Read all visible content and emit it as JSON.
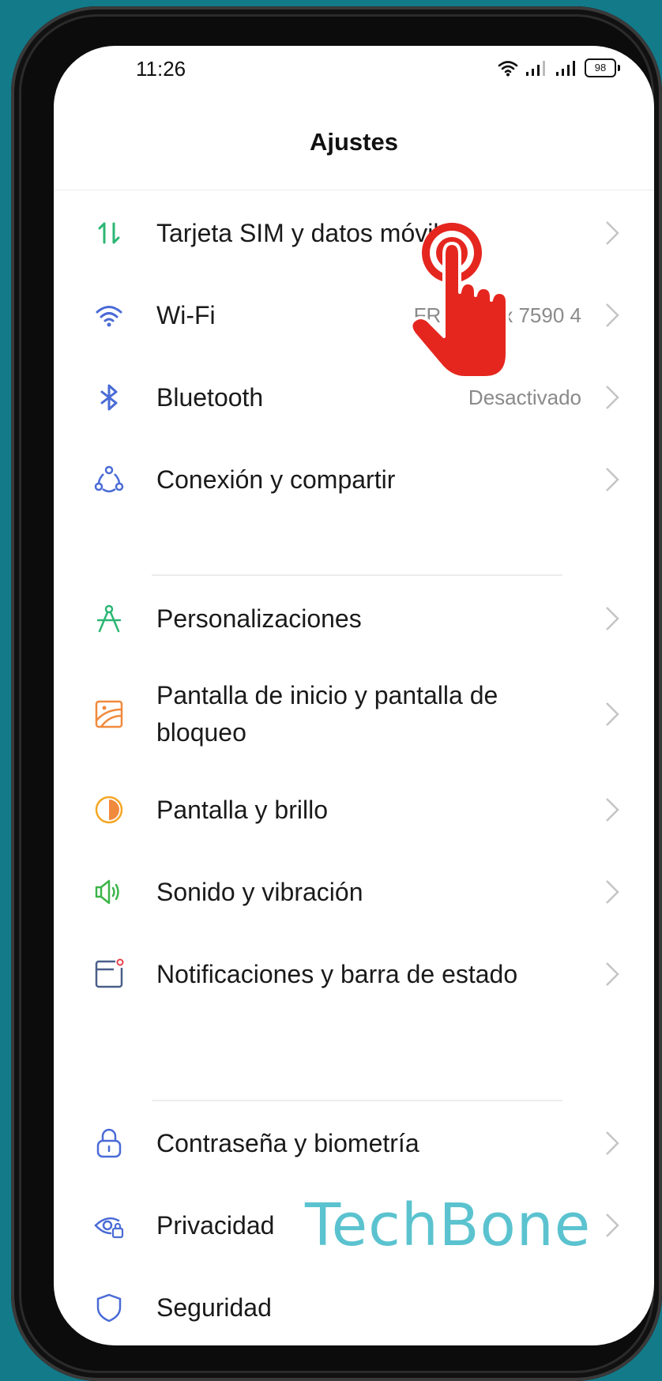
{
  "status_bar": {
    "time": "11:26",
    "battery": "98"
  },
  "header": {
    "title": "Ajustes"
  },
  "groups": [
    [
      {
        "id": "sim",
        "label": "Tarjeta SIM y datos móviles",
        "value": "",
        "icon": "sim-data-icon",
        "color": "#2bb673"
      },
      {
        "id": "wifi",
        "label": "Wi-Fi",
        "value": "FRITZ!Box 7590 4",
        "icon": "wifi-icon",
        "color": "#4a6bd6"
      },
      {
        "id": "bluetooth",
        "label": "Bluetooth",
        "value": "Desactivado",
        "icon": "bluetooth-icon",
        "color": "#4a6bd6"
      },
      {
        "id": "share",
        "label": "Conexión y compartir",
        "value": "",
        "icon": "connection-share-icon",
        "color": "#4a6bd6"
      }
    ],
    [
      {
        "id": "custom",
        "label": "Personalizaciones",
        "value": "",
        "icon": "compass-icon",
        "color": "#2bb673"
      },
      {
        "id": "home",
        "label": "Pantalla de inicio y pantalla de bloqueo",
        "label_lines": [
          "Pantalla de inicio y pantalla de",
          "bloqueo"
        ],
        "value": "",
        "icon": "wallpaper-icon",
        "color": "#f08a3c"
      },
      {
        "id": "display",
        "label": "Pantalla y brillo",
        "value": "",
        "icon": "brightness-icon",
        "color": "#f5a623"
      },
      {
        "id": "sound",
        "label": "Sonido y vibración",
        "value": "",
        "icon": "speaker-icon",
        "color": "#3cb54a"
      },
      {
        "id": "notif",
        "label": "Notificaciones y barra de estado",
        "value": "",
        "icon": "notification-icon",
        "color": "#4a5f8a"
      }
    ],
    [
      {
        "id": "password",
        "label": "Contraseña y biometría",
        "value": "",
        "icon": "lock-icon",
        "color": "#4a6bd6"
      },
      {
        "id": "privacy",
        "label": "Privacidad",
        "value": "",
        "icon": "privacy-eye-icon",
        "color": "#4a6bd6"
      },
      {
        "id": "security",
        "label": "Seguridad",
        "value": "",
        "icon": "shield-icon",
        "color": "#4a6bd6"
      }
    ]
  ],
  "watermark": "TechBone"
}
